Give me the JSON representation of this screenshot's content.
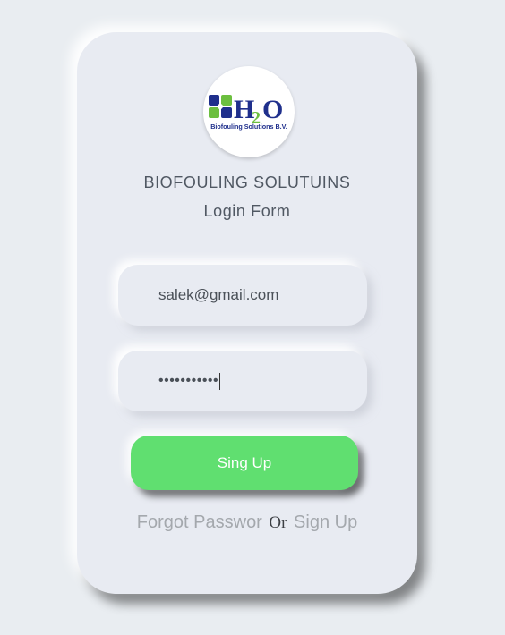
{
  "logo": {
    "text_h": "H",
    "text_2": "2",
    "text_o": "O",
    "subtitle": "Biofouling Solutions B.V."
  },
  "header": {
    "brand": "BIOFOULING SOLUTUINS",
    "form_title": "Login Form"
  },
  "form": {
    "email_value": "salek@gmail.com",
    "password_mask": "•••••••••••",
    "submit_label": "Sing Up"
  },
  "footer": {
    "forgot_label": "Forgot Passwor",
    "or_label": "Or",
    "signup_label": "Sign Up"
  },
  "colors": {
    "background": "#e9edf1",
    "card": "#e8ebf2",
    "button": "#60df70",
    "logo_blue": "#1f2f8c",
    "logo_green": "#6cbf3f"
  }
}
